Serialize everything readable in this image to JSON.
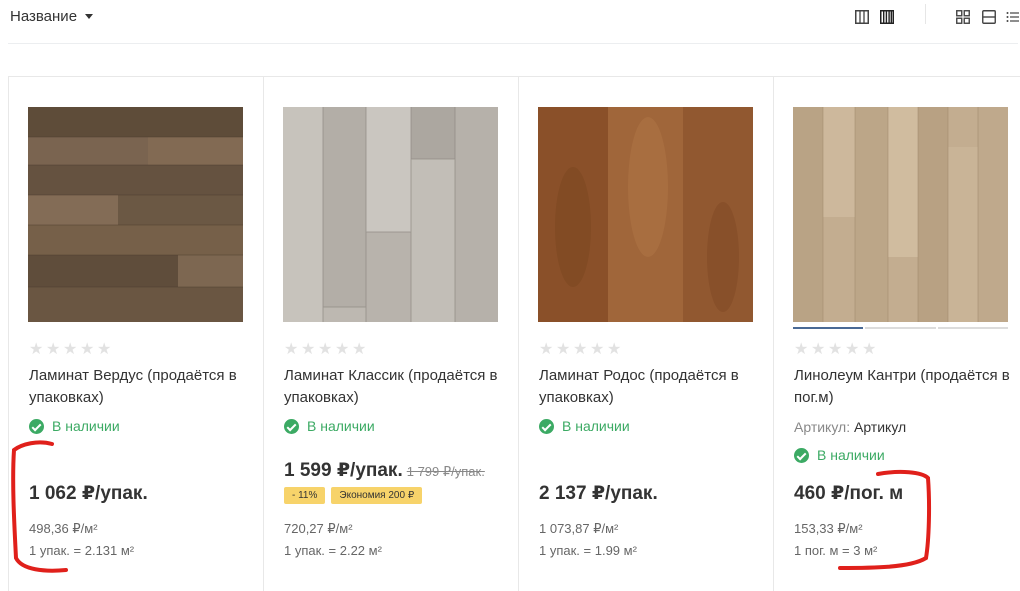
{
  "toolbar": {
    "sort_label": "Название",
    "icons": [
      "columns-icon",
      "columns-dense-icon",
      "grid-view-icon",
      "list-view-icon",
      "menu-list-icon"
    ]
  },
  "products": [
    {
      "rating_stars": 5,
      "title": "Ламинат Вердус (продаётся в упаковках)",
      "availability": "В наличии",
      "price": "1 062 ₽/упак.",
      "price_per_m2": "498,36 ₽/м²",
      "unit_info": "1 упак. = 2.131 м²"
    },
    {
      "rating_stars": 5,
      "title": "Ламинат Классик (продаётся в упаковках)",
      "availability": "В наличии",
      "price": "1 599 ₽/упак.",
      "old_price": "1 799 ₽/упак.",
      "discount_badge": "- 11%",
      "savings_badge": "Экономия 200 ₽",
      "price_per_m2": "720,27 ₽/м²",
      "unit_info": "1 упак. = 2.22 м²"
    },
    {
      "rating_stars": 5,
      "title": "Ламинат Родос (продаётся в упаковках)",
      "availability": "В наличии",
      "price": "2 137 ₽/упак.",
      "price_per_m2": "1 073,87 ₽/м²",
      "unit_info": "1 упак. = 1.99 м²"
    },
    {
      "rating_stars": 5,
      "title": "Линолеум Кантри (продаётся в пог.м)",
      "sku_label": "Артикул:",
      "sku_value": "Артикул",
      "availability": "В наличии",
      "price": "460 ₽/пог. м",
      "price_per_m2": "153,33 ₽/м²",
      "unit_info": "1 пог. м = 3 м²"
    }
  ],
  "colors": {
    "in_stock": "#3caa64",
    "badge": "#f7d36a",
    "marker": "#e0201b"
  }
}
